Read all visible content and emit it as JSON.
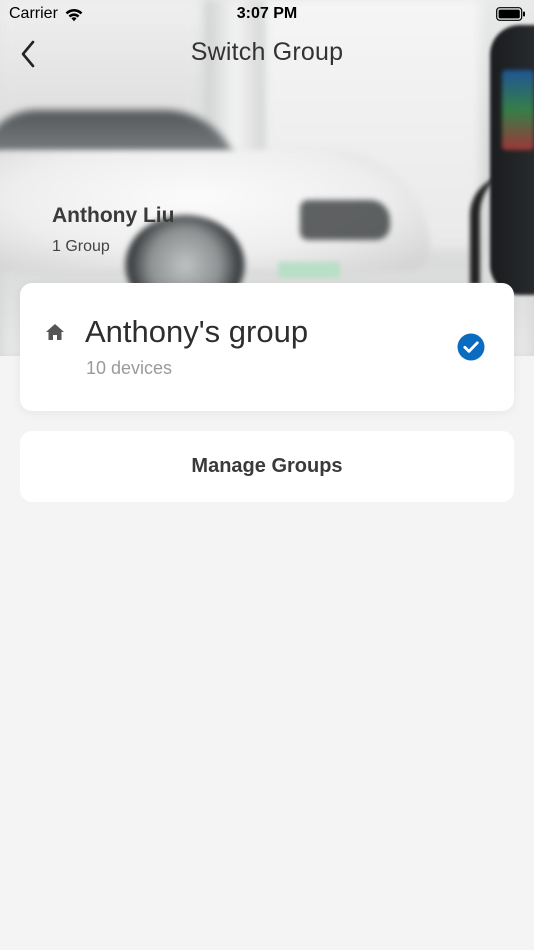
{
  "status_bar": {
    "carrier": "Carrier",
    "time": "3:07 PM",
    "wifi_icon": "wifi-icon",
    "battery_icon": "battery-icon"
  },
  "nav": {
    "title": "Switch Group",
    "back_icon": "chevron-left-icon"
  },
  "user": {
    "name": "Anthony Liu",
    "group_count": "1 Group"
  },
  "groups": [
    {
      "name": "Anthony's group",
      "devices": "10 devices",
      "icon": "home-icon",
      "selected": true,
      "selected_icon": "check-circle-icon"
    }
  ],
  "actions": {
    "manage_groups": "Manage Groups"
  },
  "colors": {
    "accent": "#0a6cc0",
    "background": "#f4f4f4",
    "card": "#ffffff"
  }
}
